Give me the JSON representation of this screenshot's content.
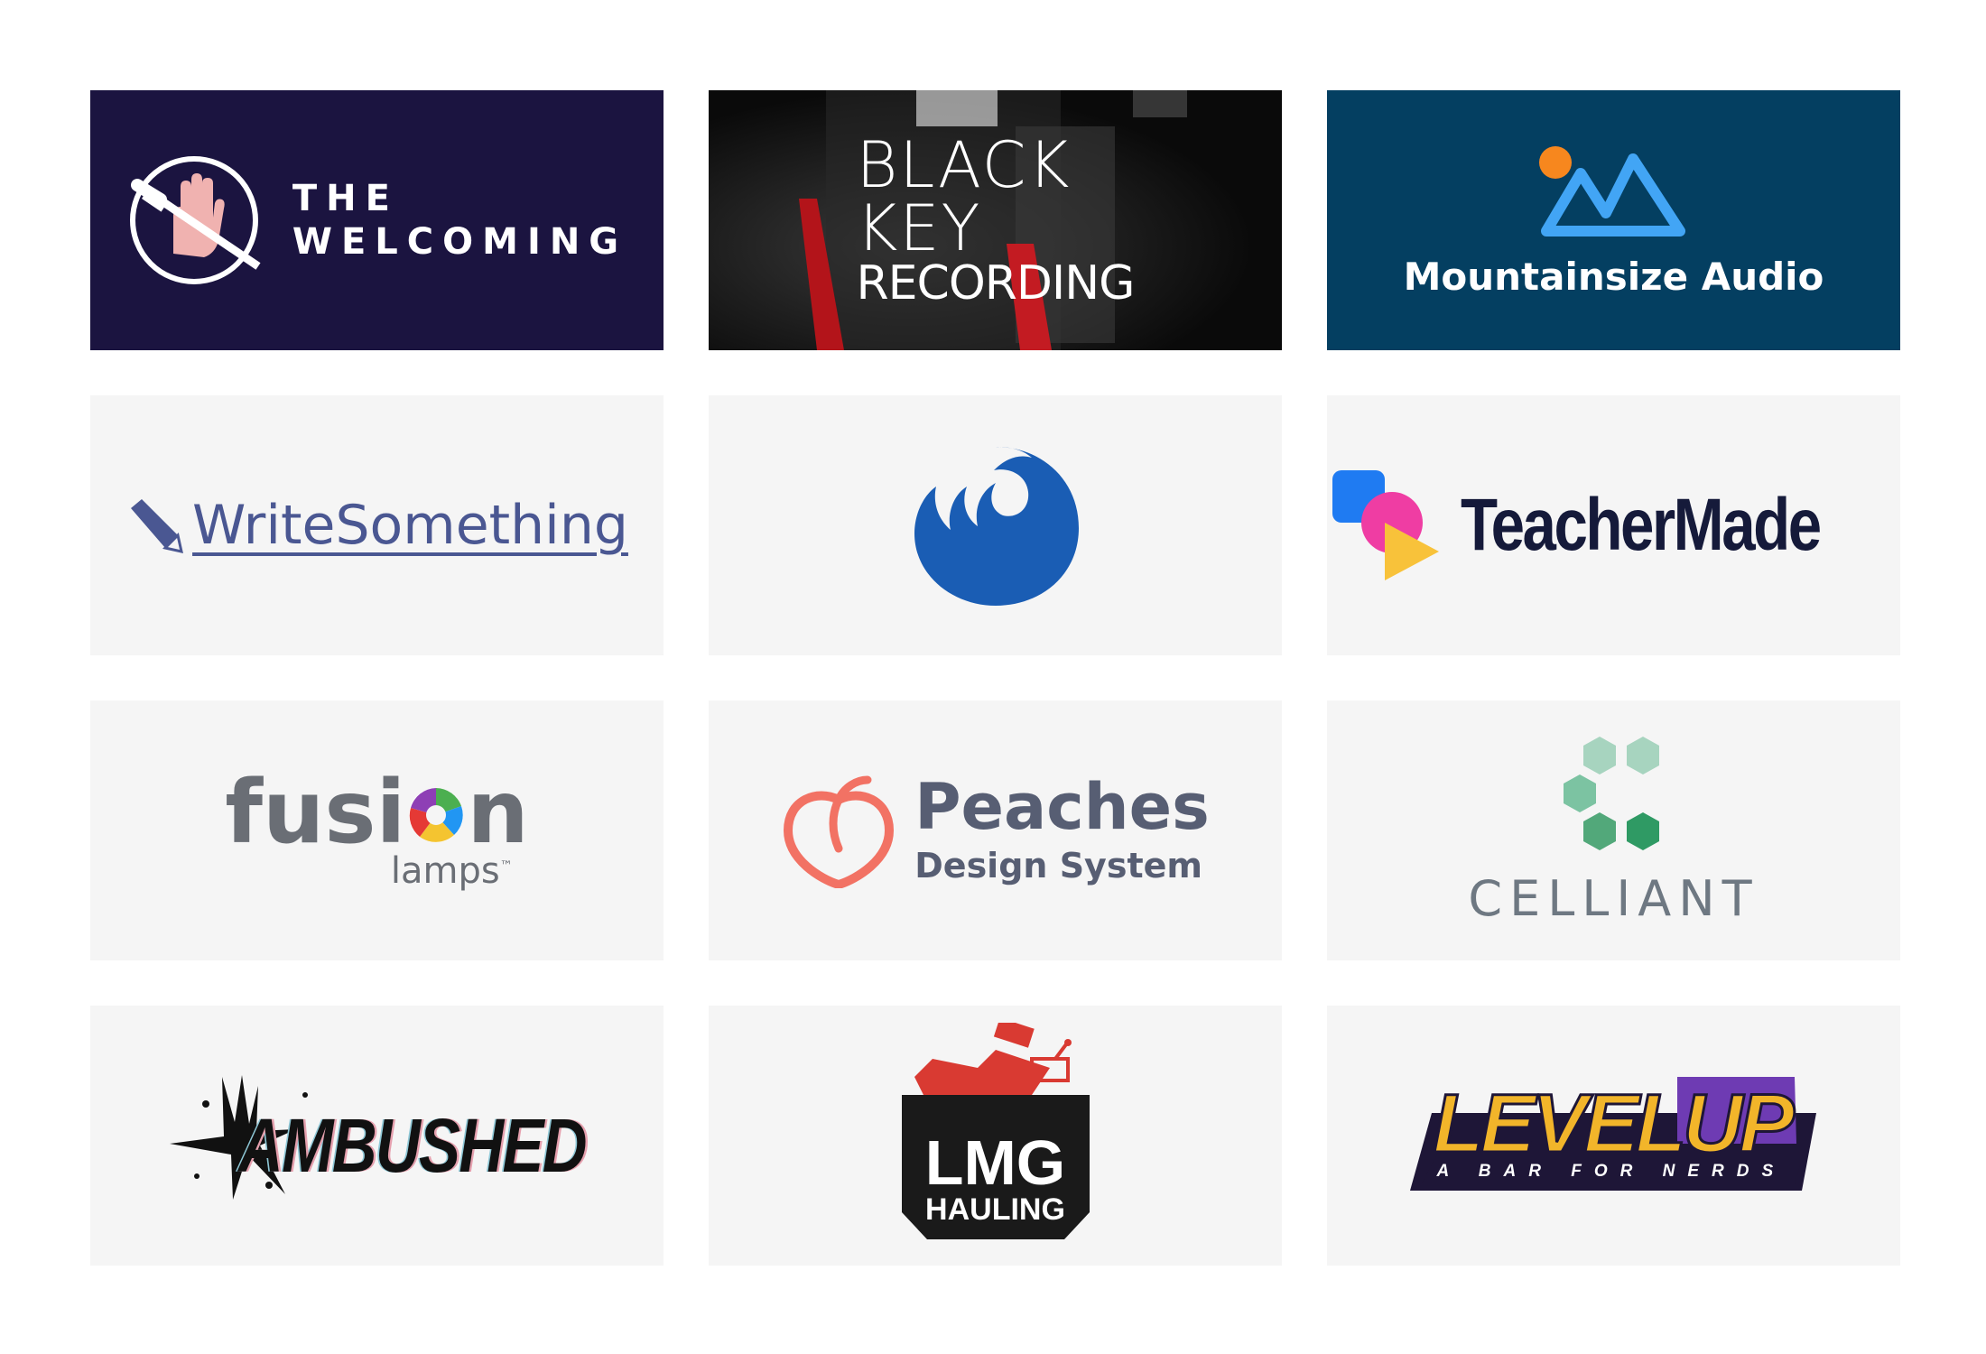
{
  "logos": {
    "welcoming": {
      "line1": "THE",
      "line2": "WELCOMING",
      "bg": "#1b1440"
    },
    "black_key": {
      "line1": "BLACK",
      "line2": "KEY",
      "line3": "RECORDING",
      "bg": "#0c0c0c"
    },
    "mountainsize": {
      "name": "Mountainsize Audio",
      "bg": "#043f61",
      "accent": "#42a5f5",
      "dot": "#f7871e"
    },
    "write_something": {
      "name": "WriteSomething",
      "color": "#4a5792"
    },
    "bird": {
      "icon": "blue-bird-icon",
      "color": "#1a5db4"
    },
    "teachermade": {
      "name": "TeacherMade",
      "color": "#151a3a"
    },
    "fusion": {
      "main_pre": "fusi",
      "main_post": "n",
      "sub": "lamps",
      "tm": "™",
      "color": "#6a6e75"
    },
    "peaches": {
      "title": "Peaches",
      "subtitle": "Design System",
      "peach_color": "#f27264",
      "text_color": "#575e73"
    },
    "celliant": {
      "name": "CELLIANT",
      "hex_color": "#52a87a"
    },
    "ambushed": {
      "name": "AMBUSHED"
    },
    "lmg": {
      "title": "LMG",
      "subtitle": "HAULING",
      "accent": "#d93a32"
    },
    "level_up": {
      "part1": "LEVEL",
      "part2": "UP",
      "tagline": "A BAR FOR NERDS",
      "accent": "#f2b52a",
      "shadow": "#6e3bb3"
    }
  }
}
